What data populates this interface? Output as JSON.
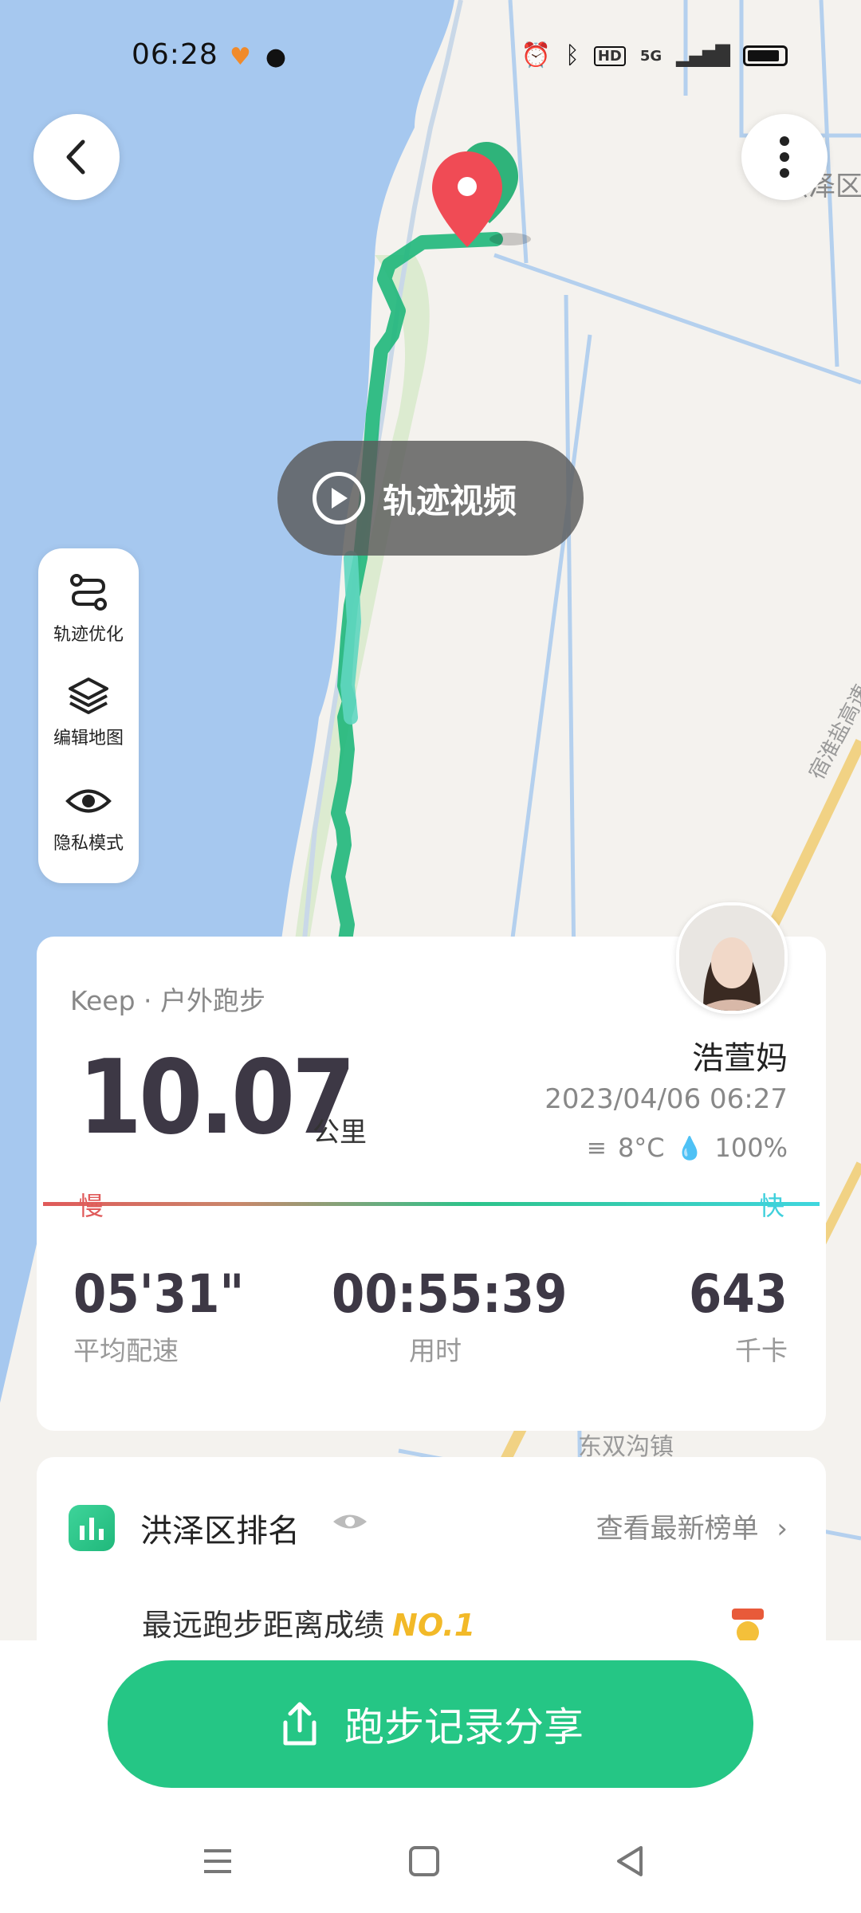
{
  "status_bar": {
    "time": "06:28",
    "hd": "HD",
    "signal": "5G"
  },
  "map": {
    "video_label": "轨迹视频",
    "district_label": "洪泽区",
    "town_label": "东双沟镇",
    "road_label": "宿淮盐高速"
  },
  "tools": [
    {
      "label": "轨迹优化",
      "icon": "route-icon"
    },
    {
      "label": "编辑地图",
      "icon": "layers-icon"
    },
    {
      "label": "隐私模式",
      "icon": "eye-icon"
    }
  ],
  "summary": {
    "source": "Keep · 户外跑步",
    "distance": "10.07",
    "unit": "公里",
    "user_name": "浩萱妈",
    "datetime": "2023/04/06 06:27",
    "temperature": "8°C",
    "humidity": "100%",
    "slow_label": "慢",
    "fast_label": "快",
    "stats": [
      {
        "value": "05'31\"",
        "label": "平均配速"
      },
      {
        "value": "00:55:39",
        "label": "用时"
      },
      {
        "value": "643",
        "label": "千卡"
      }
    ]
  },
  "ranking": {
    "title": "洪泽区排名",
    "link": "查看最新榜单",
    "record_text": "最远跑步距离成绩",
    "record_badge": "NO.1"
  },
  "share_button": {
    "label": "跑步记录分享"
  },
  "colors": {
    "accent_green": "#25c685",
    "route_green": "#1fb77a",
    "pin_red": "#f04b55",
    "water_blue": "#a6c8ef"
  }
}
